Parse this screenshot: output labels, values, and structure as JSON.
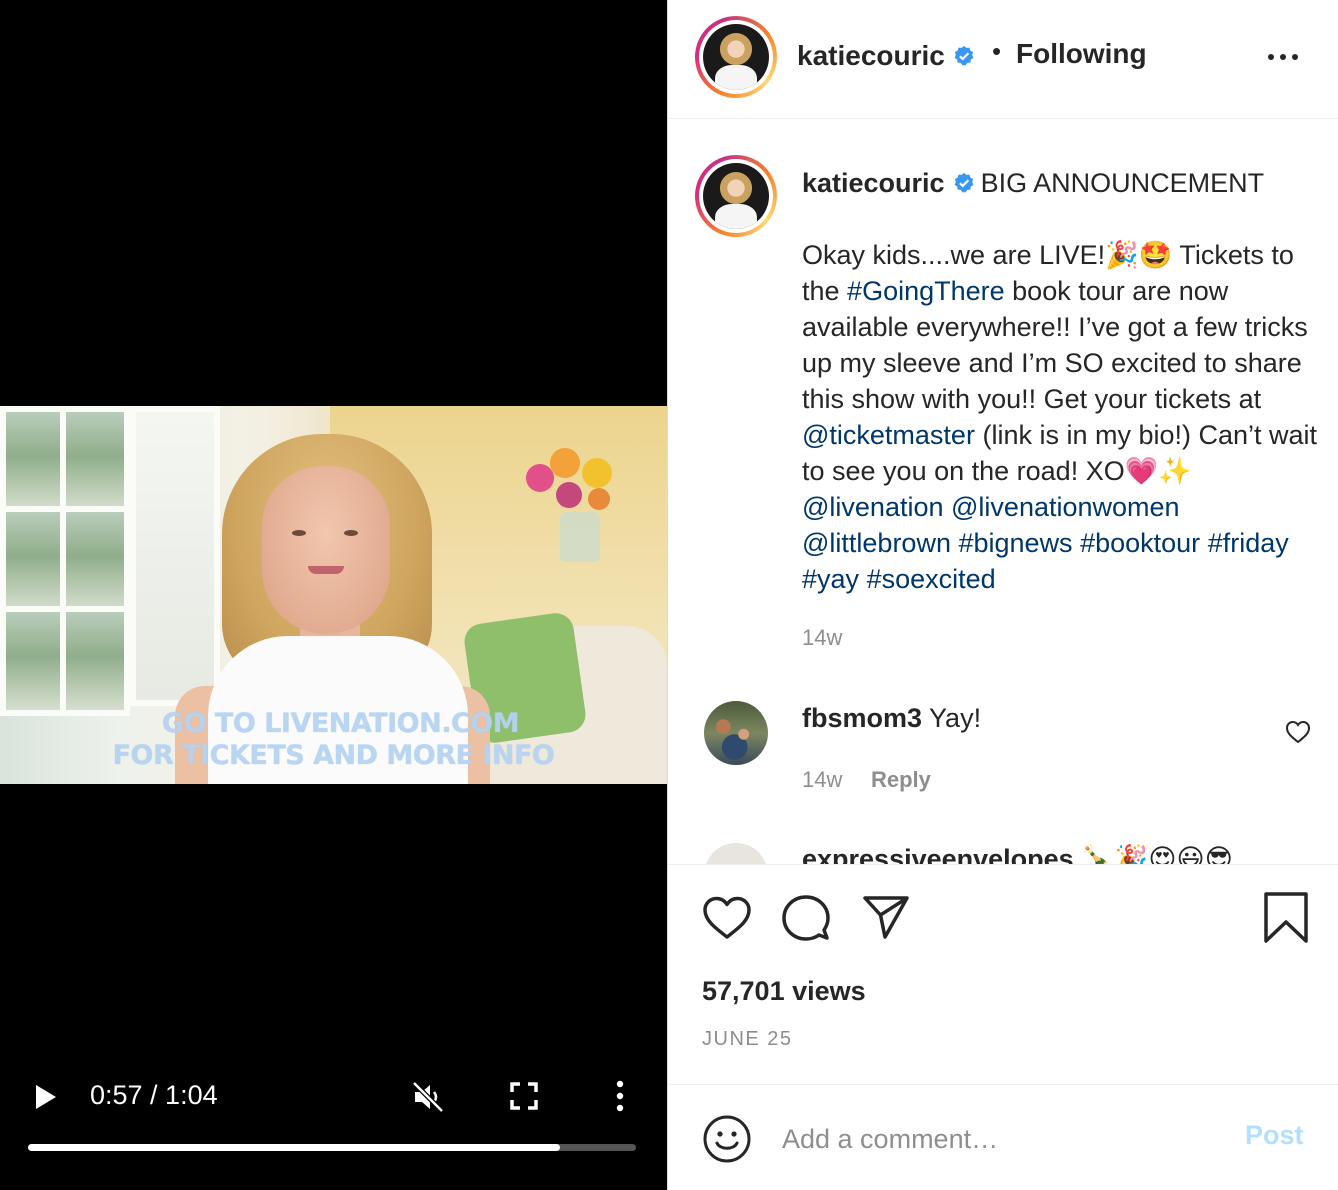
{
  "video": {
    "overlay_line_1": "GO TO LIVENATION.COM",
    "overlay_line_2": "FOR TICKETS AND MORE INFO",
    "time_display": "0:57 / 1:04",
    "progress_fraction": 0.875,
    "icons": {
      "play": "play-icon",
      "mute": "muted-speaker-icon",
      "fullscreen": "fullscreen-icon",
      "more": "vertical-ellipsis-icon"
    }
  },
  "header": {
    "username": "katiecouric",
    "separator": "•",
    "follow_status": "Following",
    "verified_icon": "verified-badge-icon",
    "options_icon": "horizontal-ellipsis-icon"
  },
  "caption": {
    "username": "katiecouric",
    "heading": "BIG ANNOUNCEMENT",
    "segments": [
      {
        "text": "Okay kids....we are LIVE!🎉🤩 Tickets to the ",
        "type": "text"
      },
      {
        "text": "#GoingThere",
        "type": "tag"
      },
      {
        "text": " book tour are now available everywhere!! I’ve got a few tricks up my sleeve and I’m SO excited to share this show with you!! Get your tickets at ",
        "type": "text"
      },
      {
        "text": "@ticketmaster",
        "type": "tag"
      },
      {
        "text": " (link is in my bio!) Can’t wait to see you on the road! XO💗✨ ",
        "type": "text"
      },
      {
        "text": "@livenation",
        "type": "tag"
      },
      {
        "text": " ",
        "type": "text"
      },
      {
        "text": "@livenationwomen",
        "type": "tag"
      },
      {
        "text": " ",
        "type": "text"
      },
      {
        "text": "@littlebrown",
        "type": "tag"
      },
      {
        "text": " ",
        "type": "text"
      },
      {
        "text": "#bignews",
        "type": "tag"
      },
      {
        "text": " ",
        "type": "text"
      },
      {
        "text": "#booktour",
        "type": "tag"
      },
      {
        "text": " ",
        "type": "text"
      },
      {
        "text": "#friday",
        "type": "tag"
      },
      {
        "text": " ",
        "type": "text"
      },
      {
        "text": "#yay",
        "type": "tag"
      },
      {
        "text": " ",
        "type": "text"
      },
      {
        "text": "#soexcited",
        "type": "tag"
      }
    ],
    "time": "14w"
  },
  "comments": [
    {
      "username": "fbsmom3",
      "text": "Yay!",
      "time": "14w",
      "reply_label": "Reply"
    }
  ],
  "next_comment_partial": "expressiveenvelopes 🍾🎉😍😃😎",
  "actions": {
    "like_icon": "heart-icon",
    "comment_icon": "speech-bubble-icon",
    "share_icon": "paper-plane-icon",
    "save_icon": "bookmark-icon"
  },
  "stats": {
    "views": "57,701 views",
    "date": "JUNE 25"
  },
  "comment_box": {
    "emoji_icon": "smiley-icon",
    "placeholder": "Add a comment…",
    "post_label": "Post",
    "post_color": "#b2dffc"
  },
  "colors": {
    "link": "#00376b",
    "verified": "#3897f0",
    "muted_text": "#8e8e8e"
  }
}
